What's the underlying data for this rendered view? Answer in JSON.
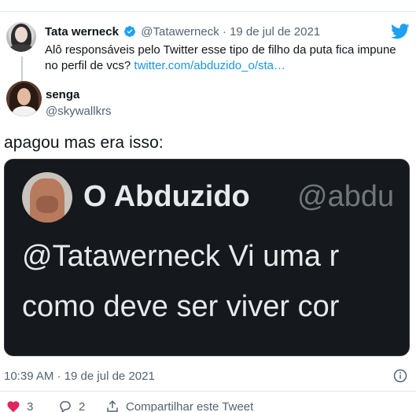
{
  "quoted_tweet": {
    "name": "Tata werneck",
    "handle": "@Tatawerneck",
    "separator": "·",
    "date": "19 de jul de 2021",
    "text": "Alô responsáveis pelo Twitter esse tipo de filho da puta fica impune no perfil de vcs?",
    "link": "twitter.com/abduzido_o/sta…"
  },
  "author": {
    "name": "senga",
    "handle": "@skywallkrs"
  },
  "tweet": {
    "text": "apagou mas era isso:",
    "timestamp": "10:39 AM · 19 de jul de 2021"
  },
  "media": {
    "name": "O Abduzido",
    "handle": "@abdu",
    "line1": "@Tatawerneck Vi uma r",
    "line2": "como deve ser viver cor"
  },
  "actions": {
    "likes": "3",
    "replies": "2",
    "share_label": "Compartilhar este Tweet"
  },
  "colors": {
    "link": "#1b95e0",
    "verified": "#1da1f2",
    "muted": "#536471",
    "like": "#e0245e"
  },
  "icons": [
    "verified-badge-icon",
    "twitter-bird-icon",
    "info-icon",
    "heart-icon",
    "reply-icon",
    "share-icon"
  ]
}
